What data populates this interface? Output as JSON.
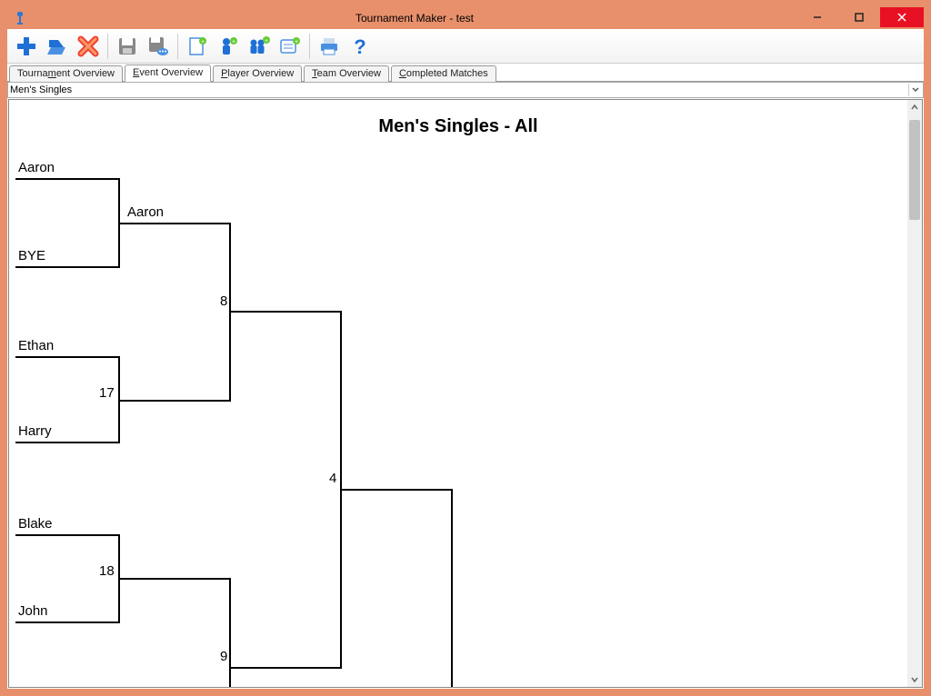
{
  "window": {
    "title": "Tournament Maker - test"
  },
  "tabs": {
    "items": [
      "Tournament Overview",
      "Event Overview",
      "Player Overview",
      "Team Overview",
      "Completed Matches"
    ],
    "active_index": 1
  },
  "dropdown": {
    "selected": "Men's Singles"
  },
  "bracket": {
    "title": "Men's Singles - All",
    "round1": [
      {
        "top": "Aaron",
        "bottom": "BYE",
        "score": ""
      },
      {
        "top": "Ethan",
        "bottom": "Harry",
        "score": "17"
      },
      {
        "top": "Blake",
        "bottom": "John",
        "score": "18"
      }
    ],
    "round2": [
      {
        "label": "Aaron",
        "score": "8"
      },
      {
        "label": "",
        "score": "9"
      }
    ],
    "round3": [
      {
        "score": "4"
      }
    ]
  },
  "toolbar_icons": [
    "plus",
    "open",
    "delete",
    "sep",
    "save",
    "save-as",
    "sep",
    "new-doc",
    "add-player",
    "add-team",
    "new-note",
    "sep",
    "print",
    "help"
  ]
}
